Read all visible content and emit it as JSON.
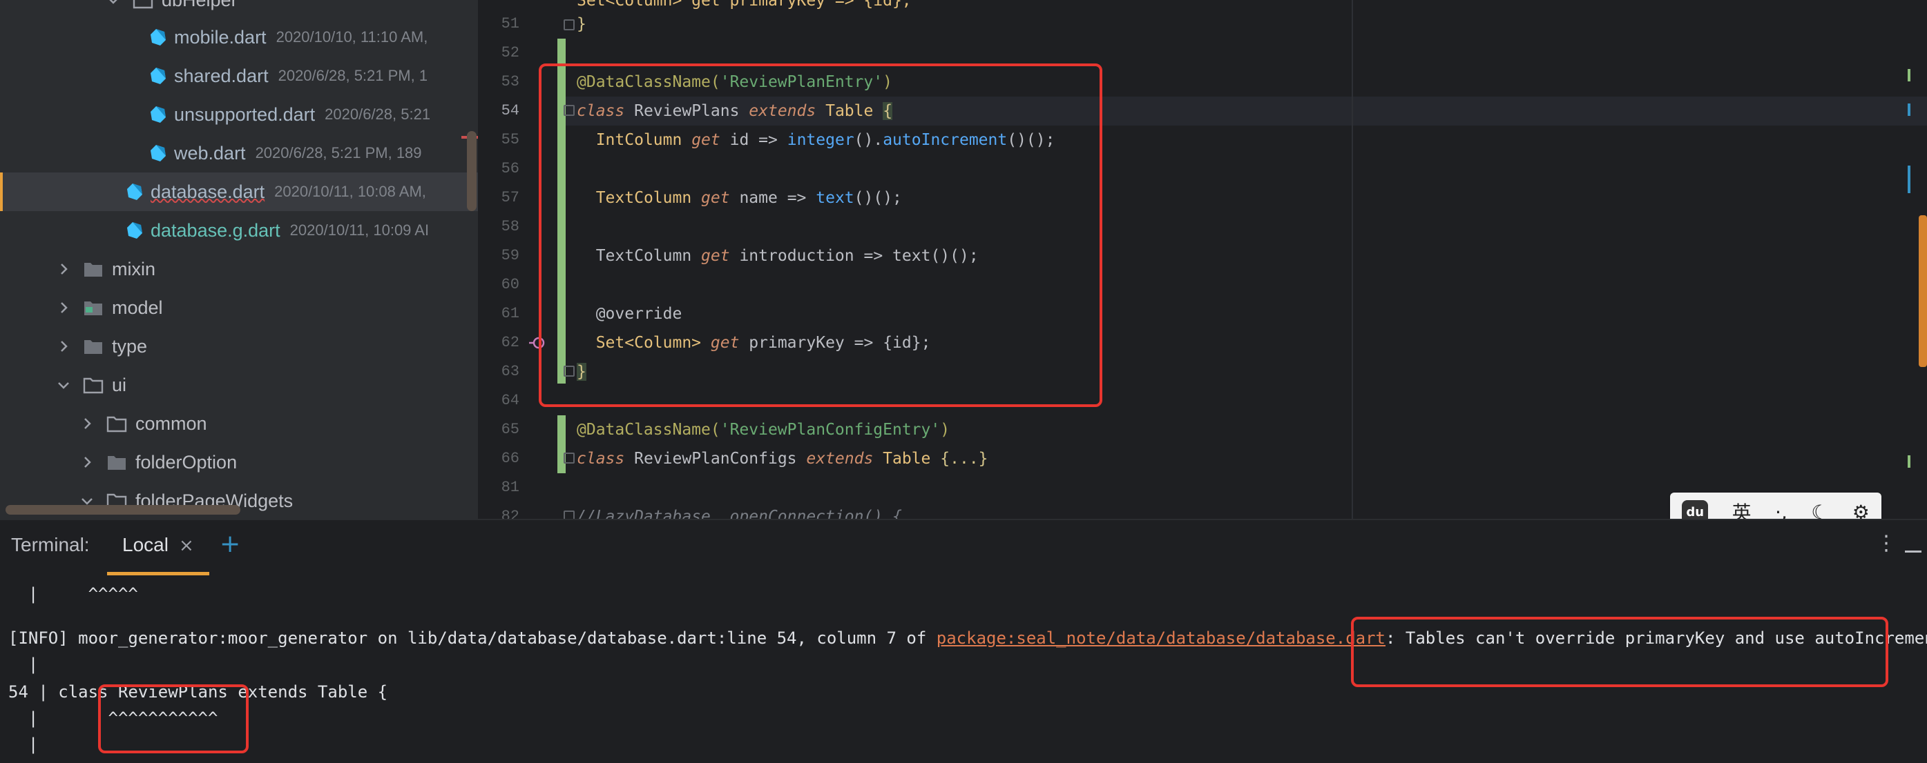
{
  "sidebar": {
    "items": [
      {
        "name": "dbHelper",
        "meta": ""
      },
      {
        "name": "mobile.dart",
        "meta": "2020/10/10, 11:10 AM,"
      },
      {
        "name": "shared.dart",
        "meta": "2020/6/28, 5:21 PM, 1"
      },
      {
        "name": "unsupported.dart",
        "meta": "2020/6/28, 5:21"
      },
      {
        "name": "web.dart",
        "meta": "2020/6/28, 5:21 PM, 189"
      },
      {
        "name": "database.dart",
        "meta": "2020/10/11, 10:08 AM,"
      },
      {
        "name": "database.g.dart",
        "meta": "2020/10/11, 10:09 AI"
      },
      {
        "name": "mixin",
        "meta": ""
      },
      {
        "name": "model",
        "meta": ""
      },
      {
        "name": "type",
        "meta": ""
      },
      {
        "name": "ui",
        "meta": ""
      },
      {
        "name": "common",
        "meta": ""
      },
      {
        "name": "folderOption",
        "meta": ""
      },
      {
        "name": "folderPageWidgets",
        "meta": ""
      }
    ]
  },
  "editor": {
    "line_numbers": [
      "51",
      "52",
      "53",
      "54",
      "55",
      "56",
      "57",
      "58",
      "59",
      "60",
      "61",
      "62",
      "63",
      "64",
      "65",
      "66",
      "81",
      "82"
    ],
    "top_partial": "Set<Column> get primaryKey => {id};",
    "lines": {
      "l51": "}",
      "l53_ann": "@DataClassName(",
      "l53_str": "'ReviewPlanEntry'",
      "l53_end": ")",
      "l54_kw": "class",
      "l54_name": "ReviewPlans",
      "l54_ext": "extends",
      "l54_typ": "Table",
      "l54_brace": "{",
      "l55_typ": "IntColumn",
      "l55_get": "get",
      "l55_id": "id",
      "l55_arrow": "=>",
      "l55_fn": "integer",
      "l55_call": "().",
      "l55_fn2": "autoIncrement",
      "l55_end": "()();",
      "l57_typ": "TextColumn",
      "l57_get": "get",
      "l57_id": "name",
      "l57_arrow": "=>",
      "l57_fn": "text",
      "l57_end": "()();",
      "l59_typ": "TextColumn",
      "l59_get": "get",
      "l59_id": "introduction",
      "l59_arrow": "=>",
      "l59_fn": "text",
      "l59_end": "()();",
      "l61_ann": "@override",
      "l62_typ": "Set<Column>",
      "l62_get": "get",
      "l62_id": "primaryKey",
      "l62_arrow": "=>",
      "l62_end": "{id};",
      "l63": "}",
      "l65_ann": "@DataClassName(",
      "l65_str": "'ReviewPlanConfigEntry'",
      "l65_end": ")",
      "l66_kw": "class",
      "l66_name": "ReviewPlanConfigs",
      "l66_ext": "extends",
      "l66_typ": "Table",
      "l66_body": "{...}",
      "l82": "//LazyDatabase _openConnection() {"
    }
  },
  "ime": {
    "logo": "du",
    "lang": "英",
    "punct": "·,",
    "moon": "☾",
    "gear": "⚙"
  },
  "terminal": {
    "title": "Terminal:",
    "tab_label": "Local",
    "close_glyph": "×",
    "add_glyph": "+",
    "menu_glyph": "⋮",
    "lines": {
      "caret1": "  |     ^^^^^",
      "info_prefix": "[INFO] moor_generator:moor_generator on lib/data/database/database.dart:line 54, column 7 of ",
      "info_link": "package:seal_note/data/database/database.dart",
      "info_suffix": ": Tables can't override primaryKey and use autoIncrement()",
      "bar1": "  |",
      "code": "54 | class ReviewPlans extends Table {",
      "caret2": "  |       ^^^^^^^^^^^",
      "bar2": "  |"
    }
  },
  "colors": {
    "accent": "#e8a03a",
    "annotation": "#e8352e",
    "link": "#e07a4f"
  }
}
